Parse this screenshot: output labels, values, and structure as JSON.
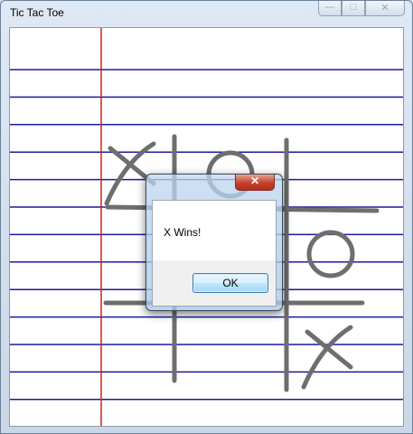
{
  "window": {
    "title": "Tic Tac Toe",
    "buttons": {
      "minimize_icon": "minimize-icon",
      "maximize_icon": "maximize-icon",
      "close_icon": "close-icon"
    }
  },
  "board": {
    "cells": [
      [
        "X",
        "O",
        ""
      ],
      [
        "",
        "",
        "O"
      ],
      [
        "",
        "",
        "X"
      ]
    ],
    "paper": {
      "line_color": "#1a1aa0",
      "margin_color": "#d22020",
      "grid_color": "#6e6e6e"
    }
  },
  "dialog": {
    "message": "X Wins!",
    "ok_label": "OK",
    "close_icon": "close-icon"
  }
}
